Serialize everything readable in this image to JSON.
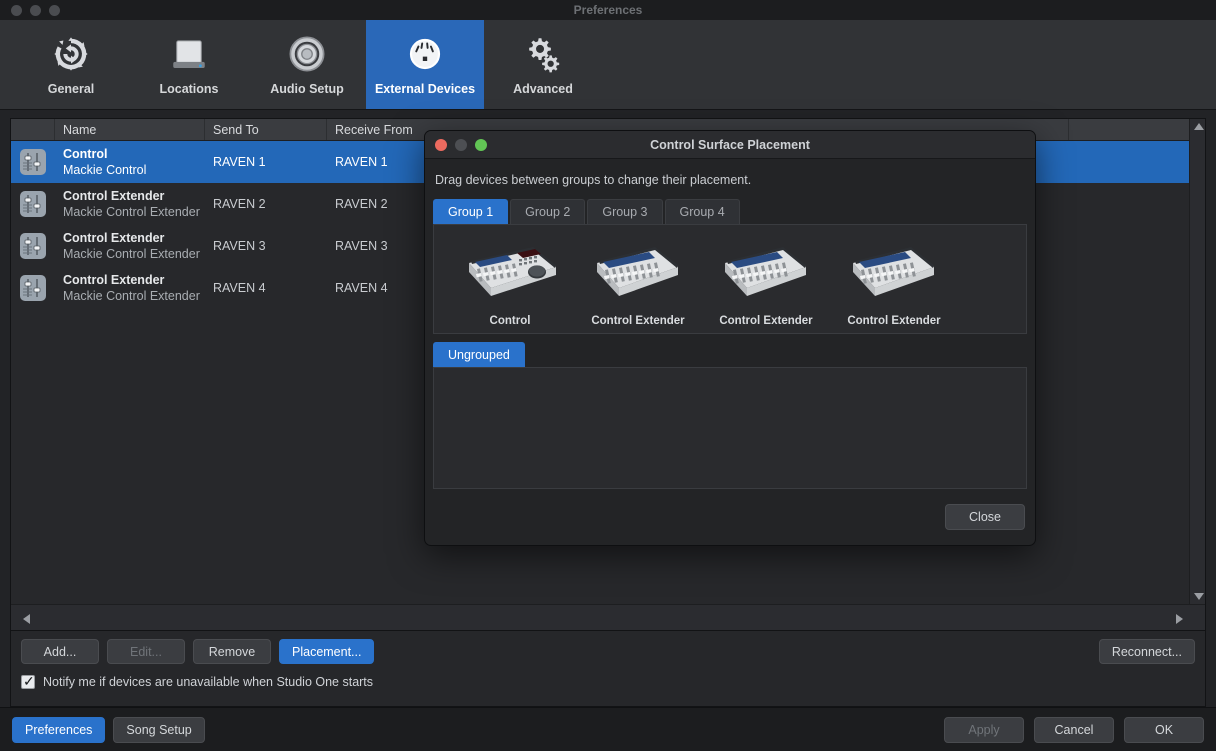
{
  "window": {
    "title": "Preferences"
  },
  "toolbar": {
    "items": [
      {
        "label": "General",
        "icon": "gear-refresh-icon",
        "active": false
      },
      {
        "label": "Locations",
        "icon": "drive-icon",
        "active": false
      },
      {
        "label": "Audio Setup",
        "icon": "speaker-icon",
        "active": false
      },
      {
        "label": "External Devices",
        "icon": "midi-port-icon",
        "active": true
      },
      {
        "label": "Advanced",
        "icon": "gears-icon",
        "active": false
      }
    ]
  },
  "device_table": {
    "columns": [
      "",
      "Name",
      "Send To",
      "Receive From"
    ],
    "rows": [
      {
        "name": "Control",
        "model": "Mackie Control",
        "send_to": "RAVEN 1",
        "receive_from": "RAVEN 1",
        "selected": true
      },
      {
        "name": "Control Extender",
        "model": "Mackie Control Extender",
        "send_to": "RAVEN 2",
        "receive_from": "RAVEN 2",
        "selected": false
      },
      {
        "name": "Control Extender",
        "model": "Mackie Control Extender",
        "send_to": "RAVEN 3",
        "receive_from": "RAVEN 3",
        "selected": false
      },
      {
        "name": "Control Extender",
        "model": "Mackie Control Extender",
        "send_to": "RAVEN 4",
        "receive_from": "RAVEN 4",
        "selected": false
      }
    ]
  },
  "actions": {
    "add": "Add...",
    "edit": "Edit...",
    "remove": "Remove",
    "placement": "Placement...",
    "reconnect": "Reconnect...",
    "notify_checkbox_label": "Notify me if devices are unavailable when Studio One starts",
    "notify_checked": true
  },
  "footer": {
    "preferences": "Preferences",
    "song_setup": "Song Setup",
    "apply": "Apply",
    "cancel": "Cancel",
    "ok": "OK"
  },
  "dialog": {
    "title": "Control Surface Placement",
    "hint": "Drag devices between groups to change their placement.",
    "group_tabs": [
      {
        "label": "Group 1",
        "active": true
      },
      {
        "label": "Group 2",
        "active": false
      },
      {
        "label": "Group 3",
        "active": false
      },
      {
        "label": "Group 4",
        "active": false
      }
    ],
    "group_devices": [
      {
        "label": "Control",
        "type": "mackie-control"
      },
      {
        "label": "Control Extender",
        "type": "mackie-control-extender"
      },
      {
        "label": "Control Extender",
        "type": "mackie-control-extender"
      },
      {
        "label": "Control Extender",
        "type": "mackie-control-extender"
      }
    ],
    "ungrouped_tab": "Ungrouped",
    "ungrouped_devices": [],
    "close": "Close"
  },
  "colors": {
    "accent": "#2a72cb",
    "selection": "#2368b8",
    "window_bg": "#222326",
    "toolbar_bg": "#313336",
    "panel_bg": "#27282b",
    "dialog_bg": "#232426"
  }
}
